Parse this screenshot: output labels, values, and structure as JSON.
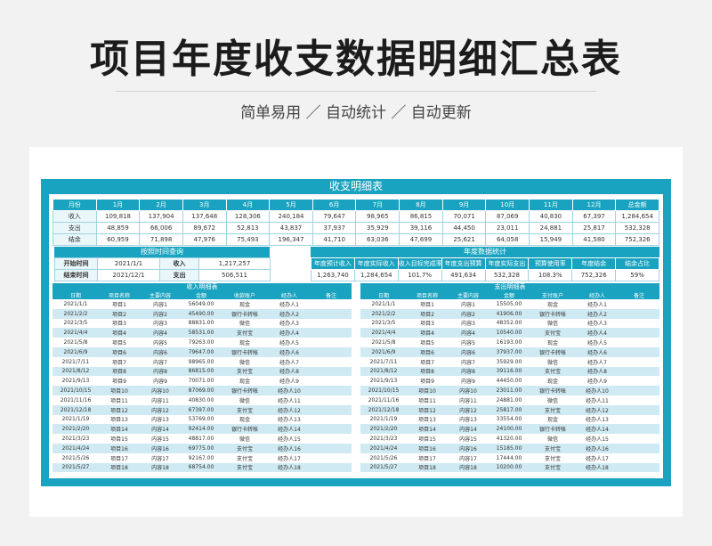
{
  "header": {
    "title": "项目年度收支数据明细汇总表",
    "subtitle": "简单易用 ／ 自动统计 ／ 自动更新"
  },
  "sheet": {
    "title": "收支明细表"
  },
  "monthly": {
    "headers": [
      "月份",
      "1月",
      "2月",
      "3月",
      "4月",
      "5月",
      "6月",
      "7月",
      "8月",
      "9月",
      "10月",
      "11月",
      "12月",
      "总金额"
    ],
    "rows": [
      [
        "收入",
        "109,818",
        "137,904",
        "137,648",
        "128,306",
        "240,184",
        "79,647",
        "98,965",
        "86,815",
        "70,071",
        "87,069",
        "40,830",
        "67,397",
        "1,284,654"
      ],
      [
        "支出",
        "48,859",
        "66,006",
        "89,672",
        "52,813",
        "43,837",
        "37,937",
        "35,929",
        "39,116",
        "44,450",
        "23,011",
        "24,881",
        "25,817",
        "532,328"
      ],
      [
        "结余",
        "60,959",
        "71,898",
        "47,976",
        "75,493",
        "196,347",
        "41,710",
        "63,036",
        "47,699",
        "25,621",
        "64,058",
        "15,949",
        "41,580",
        "752,326"
      ]
    ]
  },
  "query": {
    "title": "按照时间查询",
    "start_label": "开始时间",
    "start_date": "2021/1/1",
    "income_label": "收入",
    "income_value": "1,217,257",
    "end_label": "结束时间",
    "end_date": "2021/12/1",
    "expense_label": "支出",
    "expense_value": "506,511"
  },
  "annual": {
    "title": "年度数据统计",
    "headers": [
      "年度预计收入",
      "年度实际收入",
      "收入目标完成率",
      "年度支出预算",
      "年度实际支出",
      "预算使用率",
      "年度结余",
      "结余占比"
    ],
    "values": [
      "1,263,740",
      "1,284,654",
      "101.7%",
      "491,634",
      "532,328",
      "108.3%",
      "752,326",
      "59%"
    ]
  },
  "income_detail": {
    "title": "收入明细表",
    "headers": [
      "日期",
      "项目名称",
      "主要内容",
      "金额",
      "收款账户",
      "经办人",
      "备注"
    ],
    "rows": [
      [
        "2021/1/1",
        "项目1",
        "内容1",
        "56049.00",
        "现金",
        "经办人1",
        ""
      ],
      [
        "2021/2/2",
        "项目2",
        "内容2",
        "45490.00",
        "银行卡转帐",
        "经办人2",
        ""
      ],
      [
        "2021/3/5",
        "项目3",
        "内容3",
        "88831.00",
        "微信",
        "经办人3",
        ""
      ],
      [
        "2021/4/4",
        "项目4",
        "内容4",
        "58531.00",
        "支付宝",
        "经办人4",
        ""
      ],
      [
        "2021/5/8",
        "项目5",
        "内容5",
        "79263.00",
        "现金",
        "经办人5",
        ""
      ],
      [
        "2021/6/9",
        "项目6",
        "内容6",
        "79647.00",
        "银行卡转帐",
        "经办人6",
        ""
      ],
      [
        "2021/7/11",
        "项目7",
        "内容7",
        "98965.00",
        "微信",
        "经办人7",
        ""
      ],
      [
        "2021/8/12",
        "项目8",
        "内容8",
        "86815.00",
        "支付宝",
        "经办人8",
        ""
      ],
      [
        "2021/9/13",
        "项目9",
        "内容9",
        "70071.00",
        "现金",
        "经办人9",
        ""
      ],
      [
        "2021/10/15",
        "项目10",
        "内容10",
        "87069.00",
        "银行卡转帐",
        "经办人10",
        ""
      ],
      [
        "2021/11/16",
        "项目11",
        "内容11",
        "40830.00",
        "微信",
        "经办人11",
        ""
      ],
      [
        "2021/12/18",
        "项目12",
        "内容12",
        "67397.00",
        "支付宝",
        "经办人12",
        ""
      ],
      [
        "2021/1/19",
        "项目13",
        "内容13",
        "53769.00",
        "现金",
        "经办人13",
        ""
      ],
      [
        "2021/2/20",
        "项目14",
        "内容14",
        "92414.00",
        "银行卡转帐",
        "经办人14",
        ""
      ],
      [
        "2021/3/23",
        "项目15",
        "内容15",
        "48817.00",
        "微信",
        "经办人15",
        ""
      ],
      [
        "2021/4/24",
        "项目16",
        "内容16",
        "69775.00",
        "支付宝",
        "经办人16",
        ""
      ],
      [
        "2021/5/26",
        "项目17",
        "内容17",
        "92167.00",
        "支付宝",
        "经办人17",
        ""
      ],
      [
        "2021/5/27",
        "项目18",
        "内容18",
        "68754.00",
        "支付宝",
        "经办人18",
        ""
      ]
    ]
  },
  "expense_detail": {
    "title": "支出明细表",
    "headers": [
      "日期",
      "项目名称",
      "主要内容",
      "金额",
      "支付账户",
      "经办人",
      "备注"
    ],
    "rows": [
      [
        "2021/1/1",
        "项目1",
        "内容1",
        "15505.00",
        "现金",
        "经办人1",
        ""
      ],
      [
        "2021/2/2",
        "项目2",
        "内容2",
        "41906.00",
        "银行卡转帐",
        "经办人2",
        ""
      ],
      [
        "2021/3/5",
        "项目3",
        "内容3",
        "48352.00",
        "微信",
        "经办人3",
        ""
      ],
      [
        "2021/4/4",
        "项目4",
        "内容4",
        "10540.00",
        "支付宝",
        "经办人4",
        ""
      ],
      [
        "2021/5/8",
        "项目5",
        "内容5",
        "16193.00",
        "现金",
        "经办人5",
        ""
      ],
      [
        "2021/6/9",
        "项目6",
        "内容6",
        "37937.00",
        "银行卡转帐",
        "经办人6",
        ""
      ],
      [
        "2021/7/11",
        "项目7",
        "内容7",
        "35929.00",
        "微信",
        "经办人7",
        ""
      ],
      [
        "2021/8/12",
        "项目8",
        "内容8",
        "39116.00",
        "支付宝",
        "经办人8",
        ""
      ],
      [
        "2021/9/13",
        "项目9",
        "内容9",
        "44450.00",
        "现金",
        "经办人9",
        ""
      ],
      [
        "2021/10/15",
        "项目10",
        "内容10",
        "23011.00",
        "银行卡转帐",
        "经办人10",
        ""
      ],
      [
        "2021/11/16",
        "项目11",
        "内容11",
        "24881.00",
        "微信",
        "经办人11",
        ""
      ],
      [
        "2021/12/18",
        "项目12",
        "内容12",
        "25817.00",
        "支付宝",
        "经办人12",
        ""
      ],
      [
        "2021/1/19",
        "项目13",
        "内容13",
        "33554.00",
        "现金",
        "经办人13",
        ""
      ],
      [
        "2021/2/20",
        "项目14",
        "内容14",
        "24100.00",
        "银行卡转帐",
        "经办人14",
        ""
      ],
      [
        "2021/3/23",
        "项目15",
        "内容15",
        "41320.00",
        "微信",
        "经办人15",
        ""
      ],
      [
        "2021/4/24",
        "项目16",
        "内容16",
        "15185.00",
        "支付宝",
        "经办人16",
        ""
      ],
      [
        "2021/5/26",
        "项目17",
        "内容17",
        "17444.00",
        "支付宝",
        "经办人17",
        ""
      ],
      [
        "2021/5/27",
        "项目18",
        "内容18",
        "10200.00",
        "支付宝",
        "经办人18",
        ""
      ]
    ]
  },
  "colors": {
    "accent": "#1aa3c0",
    "row_alt": "#cfeaf2"
  }
}
